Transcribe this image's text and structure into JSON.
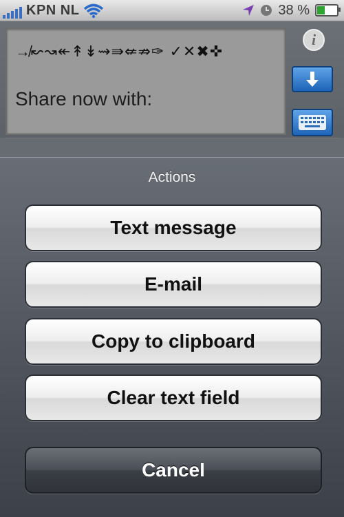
{
  "status_bar": {
    "carrier": "KPN NL",
    "battery_text": "38 %",
    "battery_level": 0.38,
    "icons": [
      "signal-bars-icon",
      "wifi-icon",
      "location-arrow-icon",
      "clock-icon",
      "battery-icon"
    ]
  },
  "editor": {
    "symbol_line": "↛↜↝↞↟↡⇝⇛⇍⇏✑ ✓✕✖✜",
    "text": "Share now with:"
  },
  "side_buttons": {
    "info": "i",
    "icons": [
      "info-icon",
      "download-arrow-icon",
      "keyboard-icon"
    ]
  },
  "action_sheet": {
    "title": "Actions",
    "buttons": [
      "Text message",
      "E-mail",
      "Copy to clipboard",
      "Clear text field"
    ],
    "cancel": "Cancel"
  },
  "colors": {
    "accent_blue": "#1e64b8",
    "sheet_bg": "#4b5058",
    "battery_green": "#2ea52e"
  }
}
